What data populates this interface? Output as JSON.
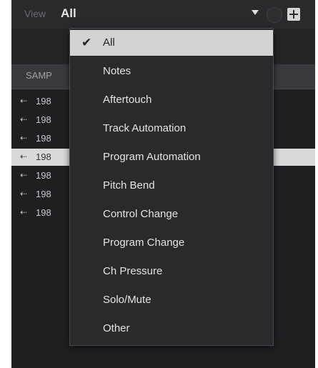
{
  "toolbar": {
    "view_label": "View",
    "view_value": "All"
  },
  "list": {
    "header": "SAMP",
    "rows": [
      {
        "text": "198",
        "selected": false
      },
      {
        "text": "198",
        "selected": false
      },
      {
        "text": "198",
        "selected": false
      },
      {
        "text": "198",
        "selected": true
      },
      {
        "text": "198",
        "selected": false
      },
      {
        "text": "198",
        "selected": false
      },
      {
        "text": "198",
        "selected": false
      }
    ]
  },
  "menu": {
    "items": [
      {
        "label": "All",
        "checked": true
      },
      {
        "label": "Notes",
        "checked": false
      },
      {
        "label": "Aftertouch",
        "checked": false
      },
      {
        "label": "Track Automation",
        "checked": false
      },
      {
        "label": "Program Automation",
        "checked": false
      },
      {
        "label": "Pitch Bend",
        "checked": false
      },
      {
        "label": "Control Change",
        "checked": false
      },
      {
        "label": "Program Change",
        "checked": false
      },
      {
        "label": "Ch Pressure",
        "checked": false
      },
      {
        "label": "Solo/Mute",
        "checked": false
      },
      {
        "label": "Other",
        "checked": false
      }
    ]
  },
  "colors": {
    "panel_bg": "#1f1f22",
    "menu_bg": "#2a2a2c",
    "selection_bg": "#d3d3d3"
  }
}
